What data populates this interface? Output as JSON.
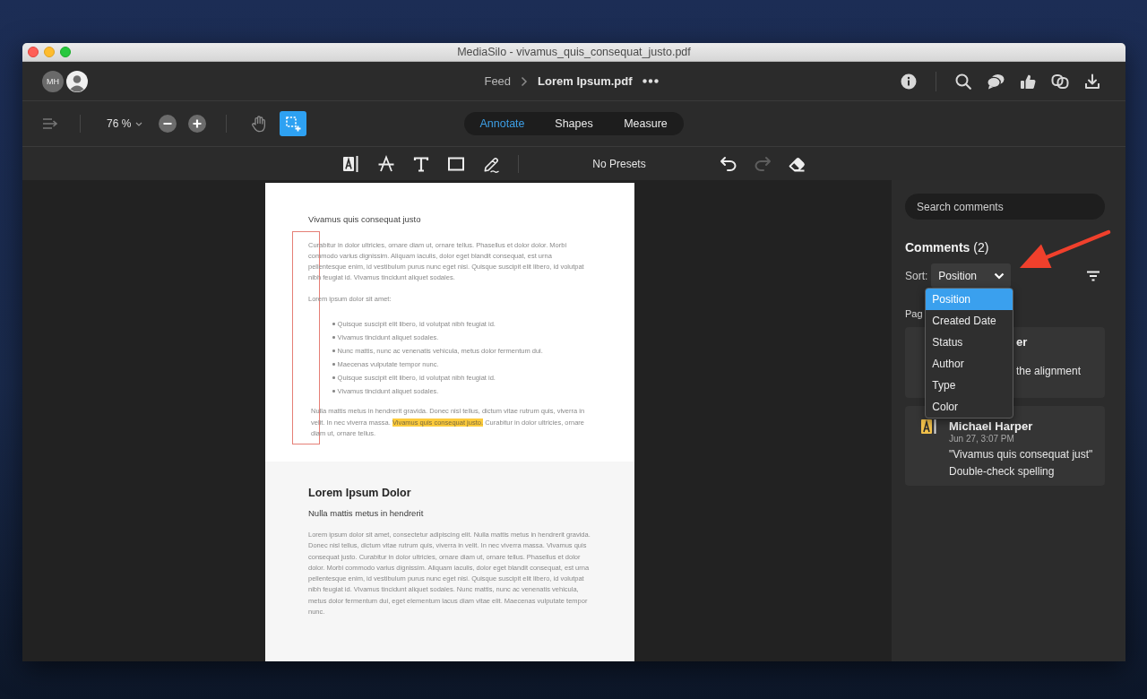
{
  "window": {
    "title": "MediaSilo - vivamus_quis_consequat_justo.pdf"
  },
  "header": {
    "avatars": [
      {
        "kind": "initials",
        "initials": "MH"
      },
      {
        "kind": "photo"
      }
    ],
    "breadcrumb": [
      "Feed",
      "Lorem Ipsum.pdf"
    ]
  },
  "toolbar": {
    "zoom": "76 %",
    "tools": [
      {
        "kind": "hand",
        "selected": false
      },
      {
        "kind": "marquee",
        "selected": true
      }
    ],
    "modes": [
      {
        "label": "Annotate",
        "selected": true
      },
      {
        "label": "Shapes",
        "selected": false
      },
      {
        "label": "Measure",
        "selected": false
      }
    ]
  },
  "annotation_bar": {
    "tools": [
      {
        "kind": "highlight"
      },
      {
        "kind": "strikethrough"
      },
      {
        "kind": "text"
      },
      {
        "kind": "rectangle"
      },
      {
        "kind": "pen"
      }
    ],
    "presets": "No Presets",
    "actions": [
      {
        "kind": "undo",
        "disabled": false
      },
      {
        "kind": "redo",
        "disabled": true
      },
      {
        "kind": "eraser",
        "disabled": false
      }
    ]
  },
  "document": {
    "page_1": {
      "heading": "Vivamus quis consequat justo",
      "paragraph": "Curabitur in dolor ultricies, ornare diam ut, ornare tellus. Phasellus et dolor dolor. Morbi commodo varius dignissim. Aliquam iaculis, dolor eget blandit consequat, est urna pellentesque enim, id vestibulum purus nunc eget nisi. Quisque suscipit elit libero, id volutpat nibh feugiat id. Vivamus tincidunt aliquet sodales.",
      "lead": "Lorem ipsum dolor sit amet:",
      "bullets": [
        "Quisque suscipit elit libero, id volutpat nibh feugiat id.",
        "Vivamus tincidunt aliquet sodales.",
        "Nunc mattis, nunc ac venenatis vehicula, metus dolor fermentum dui.",
        "Maecenas vulputate tempor nunc.",
        "Quisque suscipit elit libero, id volutpat nibh feugiat id.",
        "Vivamus tincidunt aliquet sodales."
      ],
      "closing": {
        "before": "Nulla mattis metus in hendrerit gravida. Donec nisl tellus, dictum vitae rutrum quis, viverra in velit. In nec viverra massa.",
        "highlight": "Vivamus quis consequat justo.",
        "after": "Curabitur in dolor ultricies, ornare diam ut, ornare tellus."
      }
    },
    "page_2": {
      "heading": "Lorem Ipsum Dolor",
      "subheading": "Nulla mattis metus in hendrerit",
      "paragraph": "Lorem ipsum dolor sit amet, consectetur adipiscing elit. Nulla mattis metus in hendrerit gravida. Donec nisl tellus, dictum vitae rutrum quis, viverra in velit. In nec viverra massa. Vivamus quis consequat justo. Curabitur in dolor ultricies, ornare diam ut, ornare tellus. Phasellus et dolor dolor. Morbi commodo varius dignissim. Aliquam iaculis, dolor eget blandit consequat, est urna pellentesque enim, id vestibulum purus nunc eget nisi. Quisque suscipit elit libero, id volutpat nibh feugiat id. Vivamus tincidunt aliquet sodales. Nunc mattis, nunc ac venenatis vehicula, metus dolor fermentum dui, eget elementum lacus diam vitae elit. Maecenas vulputate tempor nunc."
    }
  },
  "comments_panel": {
    "search": {
      "placeholder": "Search comments"
    },
    "title": "**Comments** (2)",
    "sort": {
      "label": "Sort:",
      "value": "Position",
      "expanded": true,
      "options": [
        {
          "label": "Position",
          "selected": true
        },
        {
          "label": "Created Date",
          "selected": false
        },
        {
          "label": "Status",
          "selected": false
        },
        {
          "label": "Author",
          "selected": false
        },
        {
          "label": "Type",
          "selected": false
        },
        {
          "label": "Color",
          "selected": false
        }
      ]
    },
    "group_label": "Pag",
    "comments": [
      {
        "kind": "obscured",
        "author": "er",
        "text": "the alignment"
      },
      {
        "kind": "highlight",
        "author": "Michael Harper",
        "date": "Jun 27, 3:07 PM",
        "quote": "\"Vivamus quis consequat just\"",
        "text": "Double-check spelling"
      }
    ]
  }
}
